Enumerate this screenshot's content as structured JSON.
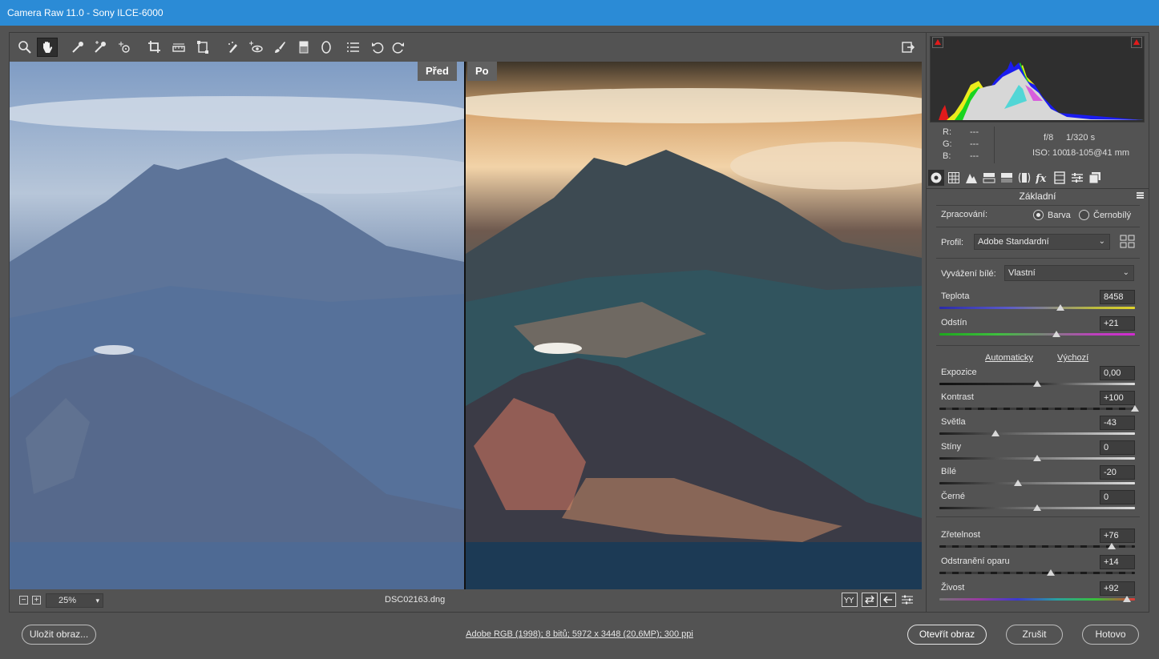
{
  "window": {
    "title": "Camera Raw 11.0  -  Sony ILCE-6000"
  },
  "toolbar": {
    "tools": [
      "zoom-tool-icon",
      "hand-tool-icon",
      "white-balance-tool-icon",
      "color-sampler-tool-icon",
      "targeted-adjustment-tool-icon",
      "crop-tool-icon",
      "straighten-tool-icon",
      "transform-tool-icon",
      "spot-removal-tool-icon",
      "red-eye-removal-tool-icon",
      "adjustment-brush-icon",
      "graduated-filter-icon",
      "radial-filter-icon",
      "preferences-list-icon",
      "rotate-left-icon",
      "rotate-right-icon"
    ],
    "active_tool": "hand-tool-icon"
  },
  "preview": {
    "before_label": "Před",
    "after_label": "Po"
  },
  "bottombar": {
    "zoom": "25%",
    "filename": "DSC02163.dng"
  },
  "histogram": {
    "readout": {
      "r_label": "R:",
      "g_label": "G:",
      "b_label": "B:",
      "r": "---",
      "g": "---",
      "b": "---",
      "aperture": "f/8",
      "shutter": "1/320 s",
      "iso": "ISO: 100",
      "lens": "18-105@41 mm"
    }
  },
  "panel": {
    "section_title": "Základní",
    "treatment": {
      "label": "Zpracování:",
      "color": "Barva",
      "bw": "Černobílý",
      "selected": "color"
    },
    "profile": {
      "label": "Profil:",
      "value": "Adobe Standardní"
    },
    "white_balance": {
      "label": "Vyvážení bílé:",
      "value": "Vlastní"
    },
    "auto_link": "Automaticky",
    "default_link": "Výchozí",
    "sliders": [
      {
        "name": "Teplota",
        "value": "8458",
        "pos": 0.62
      },
      {
        "name": "Odstín",
        "value": "+21",
        "pos": 0.6
      },
      {
        "name": "Expozice",
        "value": "0,00",
        "pos": 0.5
      },
      {
        "name": "Kontrast",
        "value": "+100",
        "pos": 1.0
      },
      {
        "name": "Světla",
        "value": "-43",
        "pos": 0.285
      },
      {
        "name": "Stíny",
        "value": "0",
        "pos": 0.5
      },
      {
        "name": "Bílé",
        "value": "-20",
        "pos": 0.4
      },
      {
        "name": "Černé",
        "value": "0",
        "pos": 0.5
      },
      {
        "name": "Zřetelnost",
        "value": "+76",
        "pos": 0.88
      },
      {
        "name": "Odstranění oparu",
        "value": "+14",
        "pos": 0.57
      },
      {
        "name": "Živost",
        "value": "+92",
        "pos": 0.96
      }
    ]
  },
  "footer": {
    "save_label": "Uložit obraz...",
    "workflow": "Adobe RGB (1998); 8 bitů; 5972 x 3448 (20,6MP); 300 ppi",
    "open_label": "Otevřít obraz",
    "cancel_label": "Zrušit",
    "done_label": "Hotovo"
  }
}
